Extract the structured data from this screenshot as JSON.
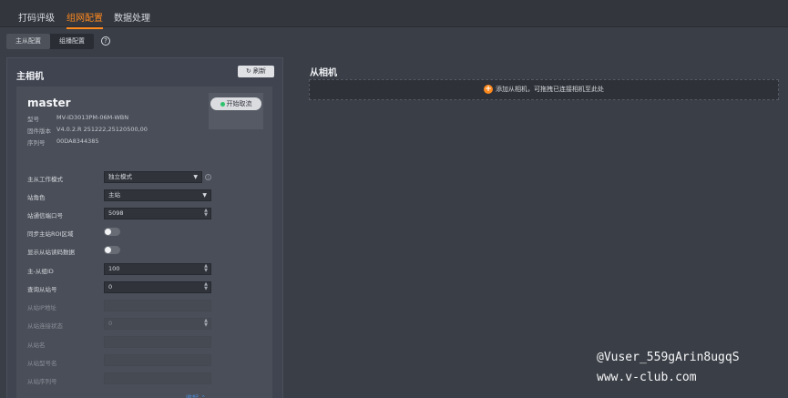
{
  "top_tabs": [
    "打码评级",
    "组网配置",
    "数据处理"
  ],
  "sub_tabs": [
    "主从配置",
    "组播配置"
  ],
  "help_symbol": "?",
  "left": {
    "title": "主相机",
    "refresh_label": "刷新",
    "camera": {
      "name": "master",
      "start_label": "开始取流",
      "info": [
        {
          "label": "型号",
          "value": "MV-ID3013PM-06M-WBN"
        },
        {
          "label": "固件版本",
          "value": "V4.0.2.R 251222,25120500,00"
        },
        {
          "label": "序列号",
          "value": "00DA8344385"
        }
      ]
    },
    "fields": {
      "mode": {
        "label": "主从工作模式",
        "value": "独立模式"
      },
      "role": {
        "label": "站角色",
        "value": "主站"
      },
      "port": {
        "label": "站通信端口号",
        "value": "5098"
      },
      "sync_roi": {
        "label": "同步主站ROI区域"
      },
      "show_slave": {
        "label": "显示从站读码数据"
      },
      "group_id": {
        "label": "主-从组ID",
        "value": "100"
      },
      "query_slave": {
        "label": "查询从站号",
        "value": "0"
      },
      "slave_ip": {
        "label": "从站IP地址",
        "value": ""
      },
      "slave_state": {
        "label": "从站连接状态",
        "value": "0"
      },
      "slave_name": {
        "label": "从站名",
        "value": ""
      },
      "slave_model": {
        "label": "从站型号名",
        "value": ""
      },
      "slave_serial": {
        "label": "从站序列号",
        "value": ""
      }
    },
    "collapse_label": "收起"
  },
  "right": {
    "title": "从相机",
    "add_text": "添加从相机，可拖拽已连接相机至此处"
  },
  "watermark": [
    "@Vuser_559gArin8ugqS",
    "www.v-club.com"
  ]
}
